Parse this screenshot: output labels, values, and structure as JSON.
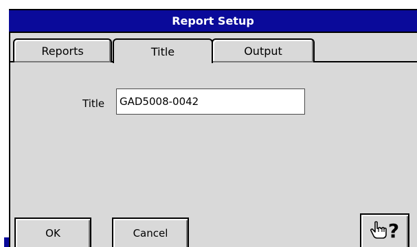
{
  "window": {
    "title": "Report Setup"
  },
  "tabs": [
    {
      "label": "Reports",
      "active": false
    },
    {
      "label": "Title",
      "active": true
    },
    {
      "label": "Output",
      "active": false
    }
  ],
  "form": {
    "title_label": "Title",
    "title_value": "GAD5008-0042"
  },
  "buttons": {
    "ok_label": "OK",
    "cancel_label": "Cancel",
    "help_icon": "pointing-hand-question-icon",
    "help_glyph": "?"
  },
  "colors": {
    "titlebar": "#0a0a9a",
    "panel": "#d9d9d9",
    "title_text": "#ffffff"
  }
}
